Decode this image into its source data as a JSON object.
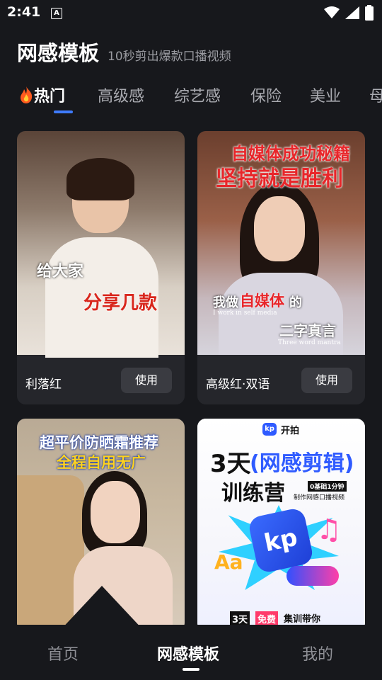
{
  "status_bar": {
    "time": "2:41",
    "notif_letter": "A"
  },
  "header": {
    "title": "网感模板",
    "subtitle": "10秒剪出爆款口播视频"
  },
  "tabs": [
    {
      "label": "热门",
      "icon": "fire-icon"
    },
    {
      "label": "高级感"
    },
    {
      "label": "综艺感"
    },
    {
      "label": "保险"
    },
    {
      "label": "美业"
    },
    {
      "label": "母"
    }
  ],
  "templates": [
    {
      "name": "利落红",
      "button": "使用",
      "overlay": [
        "给大家",
        "分享几款"
      ]
    },
    {
      "name": "高级红·双语",
      "button": "使用",
      "overlay": [
        "自媒体成功秘籍",
        "坚持就是胜利",
        "我做",
        "自媒体",
        "的",
        "I work in self media",
        "二字真言",
        "Three word mantra"
      ]
    },
    {
      "name": "",
      "button": "",
      "overlay": [
        "超平价防晒霜推荐",
        "全程自用无广"
      ]
    },
    {
      "name": "",
      "button": "",
      "overlay": [
        "开拍",
        "3天",
        "(网感剪辑)",
        "训练营",
        "0基础1分钟",
        "制作网感口播视频",
        "3天",
        "免费",
        "集训带你",
        "Aa"
      ]
    }
  ],
  "bottom_nav": [
    {
      "label": "首页"
    },
    {
      "label": "网感模板"
    },
    {
      "label": "我的"
    }
  ],
  "colors": {
    "accent": "#3f7bff",
    "background": "#17181c",
    "card": "#25262b",
    "button": "#3a3b41"
  }
}
